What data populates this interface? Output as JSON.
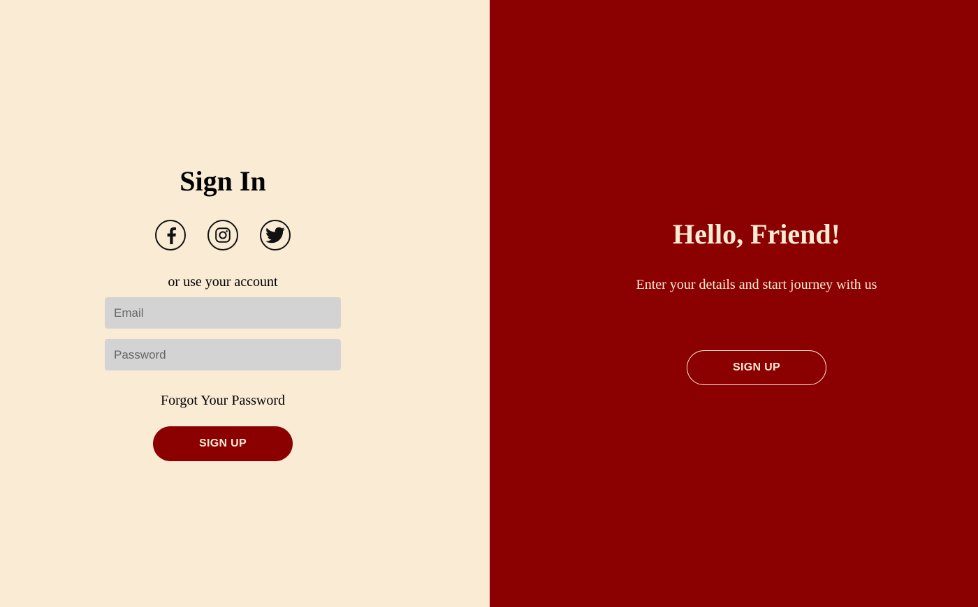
{
  "colors": {
    "left_background": "#FAEBD5",
    "right_background": "#8B0000",
    "accent": "#8B0000",
    "input_background": "#D3D3D3",
    "light_text": "#FAEBD5"
  },
  "sign_in": {
    "title": "Sign In",
    "social": [
      {
        "icon": "facebook-icon"
      },
      {
        "icon": "instagram-icon"
      },
      {
        "icon": "twitter-icon"
      }
    ],
    "or_text": "or use your account",
    "email_placeholder": "Email",
    "email_value": "",
    "password_placeholder": "Password",
    "password_value": "",
    "forgot_label": "Forgot Your Password",
    "button_label": "SIGN UP"
  },
  "overlay": {
    "title": "Hello, Friend!",
    "subtitle": "Enter your details and start journey with us",
    "button_label": "SIGN UP"
  }
}
